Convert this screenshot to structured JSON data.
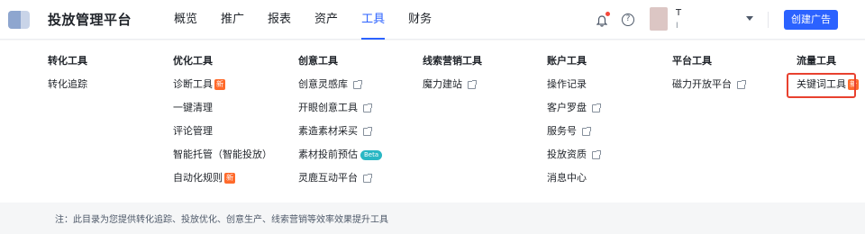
{
  "header": {
    "brand": "投放管理平台",
    "nav": [
      {
        "label": "概览",
        "active": false
      },
      {
        "label": "推广",
        "active": false
      },
      {
        "label": "报表",
        "active": false
      },
      {
        "label": "资产",
        "active": false
      },
      {
        "label": "工具",
        "active": true
      },
      {
        "label": "财务",
        "active": false
      }
    ],
    "account_name": "T",
    "account_id": "I",
    "create_button": "创建广告",
    "help_glyph": "?"
  },
  "columns": [
    {
      "title": "转化工具",
      "items": [
        {
          "label": "转化追踪",
          "external": false
        }
      ]
    },
    {
      "title": "优化工具",
      "items": [
        {
          "label": "诊断工具",
          "badge": "新"
        },
        {
          "label": "一键清理"
        },
        {
          "label": "评论管理"
        },
        {
          "label": "智能托管（智能投放）"
        },
        {
          "label": "自动化规则",
          "badge": "新"
        }
      ]
    },
    {
      "title": "创意工具",
      "items": [
        {
          "label": "创意灵感库",
          "external": true
        },
        {
          "label": "开眼创意工具",
          "external": true
        },
        {
          "label": "素造素材采买",
          "external": true
        },
        {
          "label": "素材投前预估",
          "beta": "Beta"
        },
        {
          "label": "灵鹿互动平台",
          "external": true
        }
      ]
    },
    {
      "title": "线索营销工具",
      "items": [
        {
          "label": "魔力建站",
          "external": true
        }
      ]
    },
    {
      "title": "账户工具",
      "items": [
        {
          "label": "操作记录"
        },
        {
          "label": "客户罗盘",
          "external": true
        },
        {
          "label": "服务号",
          "external": true
        },
        {
          "label": "投放资质",
          "external": true
        },
        {
          "label": "消息中心"
        }
      ]
    },
    {
      "title": "平台工具",
      "items": [
        {
          "label": "磁力开放平台",
          "external": true
        }
      ]
    },
    {
      "title": "流量工具",
      "items": [
        {
          "label": "关键词工具",
          "badge": "新"
        }
      ]
    }
  ],
  "footer_note": "注：此目录为您提供转化追踪、投放优化、创意生产、线索营销等效率效果提升工具",
  "colors": {
    "accent": "#2b62ff",
    "badge_new": "#ff6a2b",
    "highlight": "#e8412f"
  }
}
